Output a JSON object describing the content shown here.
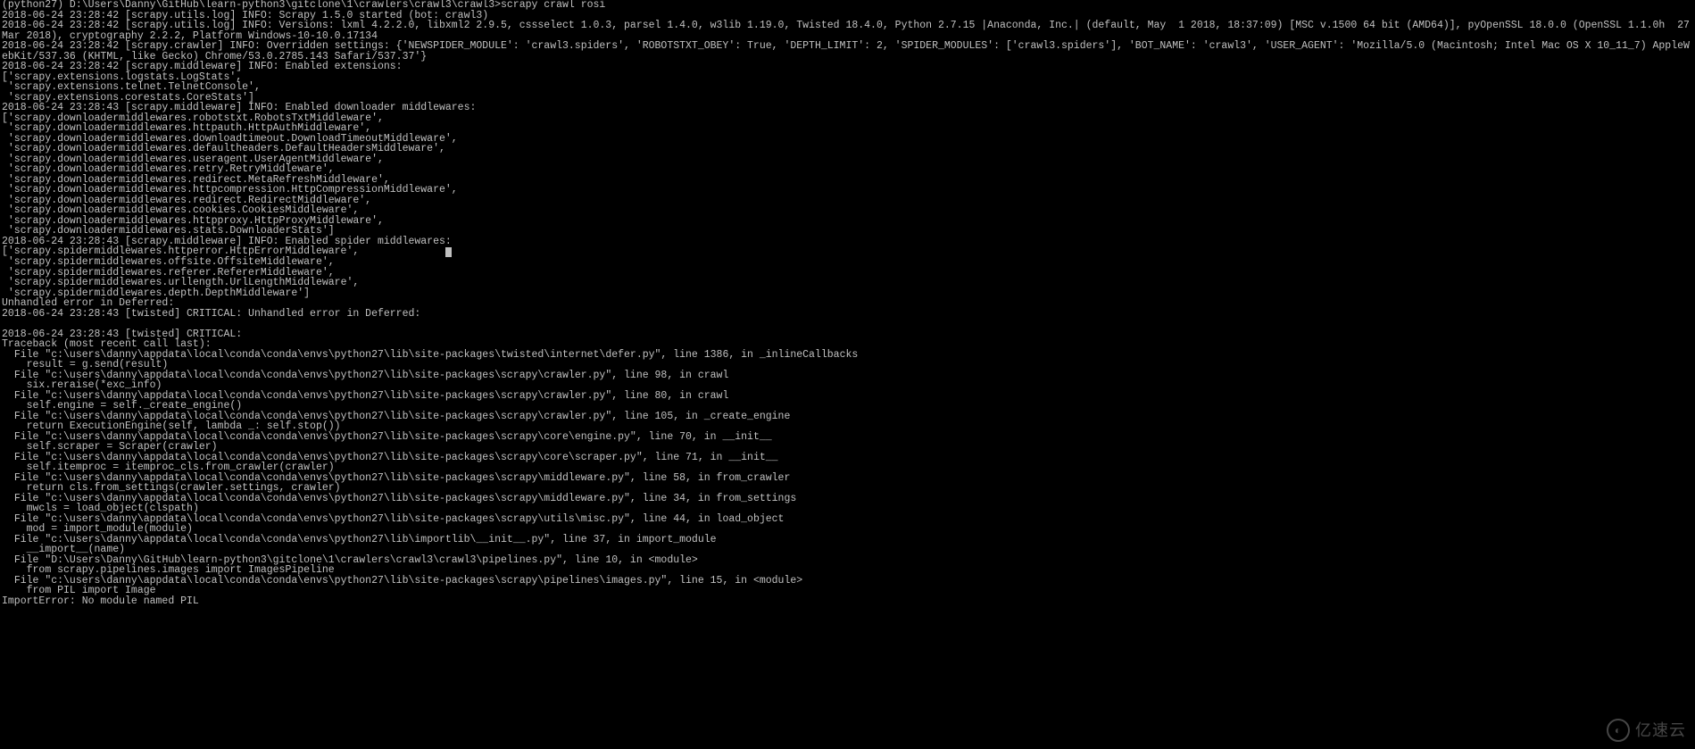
{
  "terminal": {
    "prompt_line": "(python27) D:\\Users\\Danny\\GitHub\\learn-python3\\gitclone\\1\\crawlers\\crawl3\\crawl3>scrapy crawl rosi",
    "lines": [
      "2018-06-24 23:28:42 [scrapy.utils.log] INFO: Scrapy 1.5.0 started (bot: crawl3)",
      "2018-06-24 23:28:42 [scrapy.utils.log] INFO: Versions: lxml 4.2.2.0, libxml2 2.9.5, cssselect 1.0.3, parsel 1.4.0, w3lib 1.19.0, Twisted 18.4.0, Python 2.7.15 |Anaconda, Inc.| (default, May  1 2018, 18:37:09) [MSC v.1500 64 bit (AMD64)], pyOpenSSL 18.0.0 (OpenSSL 1.1.0h  27 Mar 2018), cryptography 2.2.2, Platform Windows-10-10.0.17134",
      "2018-06-24 23:28:42 [scrapy.crawler] INFO: Overridden settings: {'NEWSPIDER_MODULE': 'crawl3.spiders', 'ROBOTSTXT_OBEY': True, 'DEPTH_LIMIT': 2, 'SPIDER_MODULES': ['crawl3.spiders'], 'BOT_NAME': 'crawl3', 'USER_AGENT': 'Mozilla/5.0 (Macintosh; Intel Mac OS X 10_11_7) AppleWebKit/537.36 (KHTML, like Gecko) Chrome/53.0.2785.143 Safari/537.37'}",
      "2018-06-24 23:28:42 [scrapy.middleware] INFO: Enabled extensions:",
      "['scrapy.extensions.logstats.LogStats',",
      " 'scrapy.extensions.telnet.TelnetConsole',",
      " 'scrapy.extensions.corestats.CoreStats']",
      "2018-06-24 23:28:43 [scrapy.middleware] INFO: Enabled downloader middlewares:",
      "['scrapy.downloadermiddlewares.robotstxt.RobotsTxtMiddleware',",
      " 'scrapy.downloadermiddlewares.httpauth.HttpAuthMiddleware',",
      " 'scrapy.downloadermiddlewares.downloadtimeout.DownloadTimeoutMiddleware',",
      " 'scrapy.downloadermiddlewares.defaultheaders.DefaultHeadersMiddleware',",
      " 'scrapy.downloadermiddlewares.useragent.UserAgentMiddleware',",
      " 'scrapy.downloadermiddlewares.retry.RetryMiddleware',",
      " 'scrapy.downloadermiddlewares.redirect.MetaRefreshMiddleware',",
      " 'scrapy.downloadermiddlewares.httpcompression.HttpCompressionMiddleware',",
      " 'scrapy.downloadermiddlewares.redirect.RedirectMiddleware',",
      " 'scrapy.downloadermiddlewares.cookies.CookiesMiddleware',",
      " 'scrapy.downloadermiddlewares.httpproxy.HttpProxyMiddleware',",
      " 'scrapy.downloadermiddlewares.stats.DownloaderStats']",
      "2018-06-24 23:28:43 [scrapy.middleware] INFO: Enabled spider middlewares:"
    ],
    "cursor_line_prefix": "['scrapy.spidermiddlewares.httperror.HttpErrorMiddleware',              ",
    "lines_after_cursor": [
      " 'scrapy.spidermiddlewares.offsite.OffsiteMiddleware',",
      " 'scrapy.spidermiddlewares.referer.RefererMiddleware',",
      " 'scrapy.spidermiddlewares.urllength.UrlLengthMiddleware',",
      " 'scrapy.spidermiddlewares.depth.DepthMiddleware']",
      "Unhandled error in Deferred:",
      "2018-06-24 23:28:43 [twisted] CRITICAL: Unhandled error in Deferred:",
      "",
      "2018-06-24 23:28:43 [twisted] CRITICAL:",
      "Traceback (most recent call last):",
      "  File \"c:\\users\\danny\\appdata\\local\\conda\\conda\\envs\\python27\\lib\\site-packages\\twisted\\internet\\defer.py\", line 1386, in _inlineCallbacks",
      "    result = g.send(result)",
      "  File \"c:\\users\\danny\\appdata\\local\\conda\\conda\\envs\\python27\\lib\\site-packages\\scrapy\\crawler.py\", line 98, in crawl",
      "    six.reraise(*exc_info)",
      "  File \"c:\\users\\danny\\appdata\\local\\conda\\conda\\envs\\python27\\lib\\site-packages\\scrapy\\crawler.py\", line 80, in crawl",
      "    self.engine = self._create_engine()",
      "  File \"c:\\users\\danny\\appdata\\local\\conda\\conda\\envs\\python27\\lib\\site-packages\\scrapy\\crawler.py\", line 105, in _create_engine",
      "    return ExecutionEngine(self, lambda _: self.stop())",
      "  File \"c:\\users\\danny\\appdata\\local\\conda\\conda\\envs\\python27\\lib\\site-packages\\scrapy\\core\\engine.py\", line 70, in __init__",
      "    self.scraper = Scraper(crawler)",
      "  File \"c:\\users\\danny\\appdata\\local\\conda\\conda\\envs\\python27\\lib\\site-packages\\scrapy\\core\\scraper.py\", line 71, in __init__",
      "    self.itemproc = itemproc_cls.from_crawler(crawler)",
      "  File \"c:\\users\\danny\\appdata\\local\\conda\\conda\\envs\\python27\\lib\\site-packages\\scrapy\\middleware.py\", line 58, in from_crawler",
      "    return cls.from_settings(crawler.settings, crawler)",
      "  File \"c:\\users\\danny\\appdata\\local\\conda\\conda\\envs\\python27\\lib\\site-packages\\scrapy\\middleware.py\", line 34, in from_settings",
      "    mwcls = load_object(clspath)",
      "  File \"c:\\users\\danny\\appdata\\local\\conda\\conda\\envs\\python27\\lib\\site-packages\\scrapy\\utils\\misc.py\", line 44, in load_object",
      "    mod = import_module(module)",
      "  File \"c:\\users\\danny\\appdata\\local\\conda\\conda\\envs\\python27\\lib\\importlib\\__init__.py\", line 37, in import_module",
      "    __import__(name)",
      "  File \"D:\\Users\\Danny\\GitHub\\learn-python3\\gitclone\\1\\crawlers\\crawl3\\crawl3\\pipelines.py\", line 10, in <module>",
      "    from scrapy.pipelines.images import ImagesPipeline",
      "  File \"c:\\users\\danny\\appdata\\local\\conda\\conda\\envs\\python27\\lib\\site-packages\\scrapy\\pipelines\\images.py\", line 15, in <module>",
      "    from PIL import Image",
      "ImportError: No module named PIL"
    ]
  },
  "watermark": {
    "text": "亿速云"
  }
}
